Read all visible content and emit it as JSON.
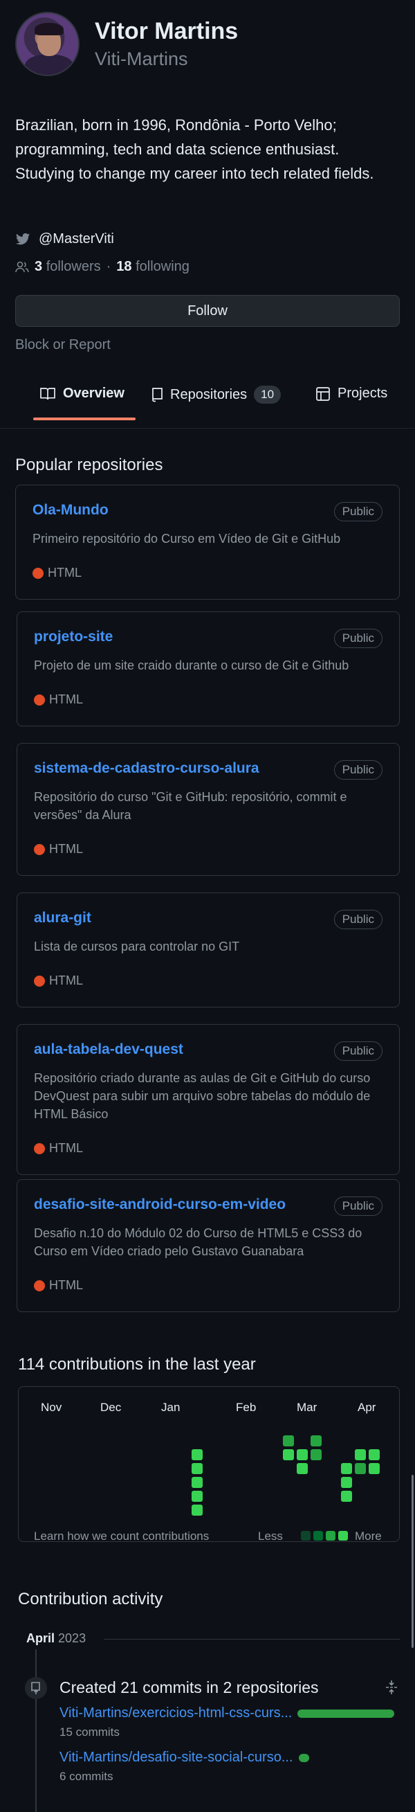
{
  "profile": {
    "name": "Vitor Martins",
    "login": "Viti-Martins",
    "bio": "Brazilian, born in 1996, Rondônia - Porto Velho; programming, tech and data science enthusiast. Studying to change my career into tech related fields.",
    "twitter": "@MasterViti",
    "followers_count": "3",
    "followers_label": "followers",
    "separator": "·",
    "following_count": "18",
    "following_label": "following",
    "follow_button": "Follow",
    "block_report": "Block or Report"
  },
  "tabs": [
    {
      "label": "Overview",
      "icon": "book-icon",
      "active": true
    },
    {
      "label": "Repositories",
      "icon": "repo-icon",
      "counter": "10"
    },
    {
      "label": "Projects",
      "icon": "table-icon"
    }
  ],
  "popular": {
    "title": "Popular repositories",
    "repos": [
      {
        "name": "Ola-Mundo",
        "visibility": "Public",
        "description": "Primeiro repositório do Curso em Vídeo de Git e GitHub",
        "language": "HTML"
      },
      {
        "name": "projeto-site",
        "visibility": "Public",
        "description": "Projeto de um site craido durante o curso de Git e Github",
        "language": "HTML"
      },
      {
        "name": "sistema-de-cadastro-curso-alura",
        "visibility": "Public",
        "description": "Repositório do curso \"Git e GitHub: repositório, commit e versões\" da Alura",
        "language": "HTML"
      },
      {
        "name": "alura-git",
        "visibility": "Public",
        "description": "Lista de cursos para controlar no GIT",
        "language": "HTML"
      },
      {
        "name": "aula-tabela-dev-quest",
        "visibility": "Public",
        "description": "Repositório criado durante as aulas de Git e GitHub do curso DevQuest para subir um arquivo sobre tabelas do módulo de HTML Básico",
        "language": "HTML"
      },
      {
        "name": "desafio-site-android-curso-em-video",
        "visibility": "Public",
        "description": "Desafio n.10 do Módulo 02 do Curso de HTML5 e CSS3 do Curso em Vídeo criado pelo Gustavo Guanabara",
        "language": "HTML"
      }
    ]
  },
  "contributions": {
    "title": "114 contributions in the last year",
    "months": [
      "Nov",
      "Dec",
      "Jan",
      "Feb",
      "Mar",
      "Apr"
    ],
    "learn_link": "Learn how we count contributions",
    "less": "Less",
    "more": "More",
    "colors": {
      "level0": "#161b22",
      "level1": "#0e4429",
      "level2": "#006d32",
      "level3": "#26a641",
      "level4": "#39d353"
    }
  },
  "activity": {
    "title": "Contribution activity",
    "month": "April",
    "year": "2023",
    "event_title": "Created 21 commits in 2 repositories",
    "repos": [
      {
        "name": "Viti-Martins/exercicios-html-css-curs...",
        "commits": "15 commits",
        "share": 0.71
      },
      {
        "name": "Viti-Martins/desafio-site-social-curso...",
        "commits": "6 commits",
        "share": 0.29
      }
    ]
  },
  "colors": {
    "background": "#0d1117",
    "link": "#4493f8",
    "muted": "#7d8590",
    "html_language": "#e34c26",
    "tab_underline": "#f78166"
  }
}
